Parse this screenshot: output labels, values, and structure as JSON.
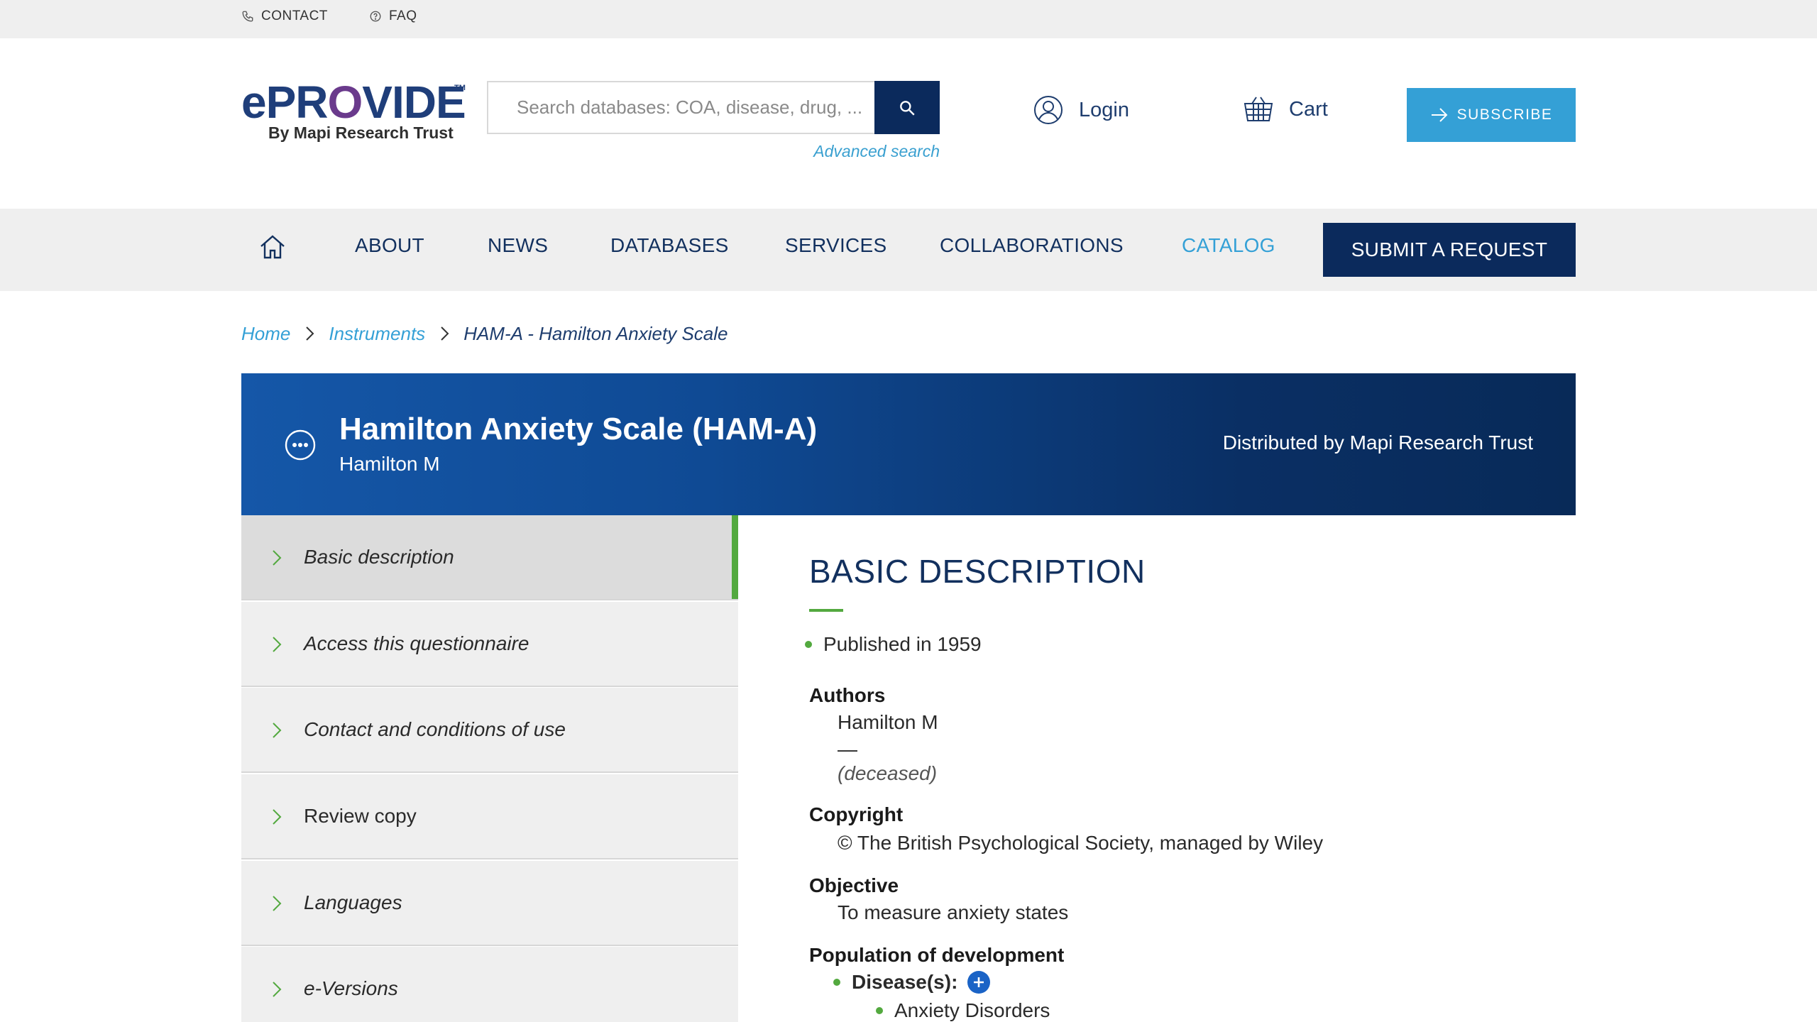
{
  "topbar": {
    "contact": "CONTACT",
    "faq": "FAQ"
  },
  "logo": {
    "brand_e": "e",
    "brand_pro": "PR",
    "brand_o": "O",
    "brand_vide": "VIDE",
    "tm": "TM",
    "subtitle": "By Mapi Research Trust"
  },
  "search": {
    "placeholder": "Search databases: COA, disease, drug, ...",
    "advanced": "Advanced search"
  },
  "header": {
    "login": "Login",
    "cart": "Cart",
    "subscribe": "SUBSCRIBE"
  },
  "nav": {
    "items": [
      "ABOUT",
      "NEWS",
      "DATABASES",
      "SERVICES",
      "COLLABORATIONS",
      "CATALOG"
    ],
    "active": "CATALOG",
    "submit": "SUBMIT A REQUEST"
  },
  "breadcrumb": {
    "home": "Home",
    "instruments": "Instruments",
    "current": "HAM-A - Hamilton Anxiety Scale"
  },
  "banner": {
    "title": "Hamilton Anxiety Scale (HAM-A)",
    "author": "Hamilton M",
    "distributor": "Distributed by Mapi Research Trust"
  },
  "sidebar": {
    "items": [
      {
        "label": "Basic description",
        "active": true
      },
      {
        "label": "Access this questionnaire"
      },
      {
        "label": "Contact and conditions of use"
      },
      {
        "label": "Review copy"
      },
      {
        "label": "Languages"
      },
      {
        "label": "e-Versions"
      }
    ]
  },
  "content": {
    "heading": "BASIC DESCRIPTION",
    "published": "Published in 1959",
    "authors_label": "Authors",
    "author_name": "Hamilton M",
    "author_dash": "—",
    "author_note": "(deceased)",
    "copyright_label": "Copyright",
    "copyright_value": "© The British Psychological Society, managed by Wiley",
    "objective_label": "Objective",
    "objective_value": "To measure anxiety states",
    "population_label": "Population of development",
    "diseases_label": "Disease(s):",
    "disease_item": "Anxiety Disorders"
  },
  "colors": {
    "navy": "#0b2a5c",
    "accent_blue": "#34a0d6",
    "green": "#53a93f"
  }
}
